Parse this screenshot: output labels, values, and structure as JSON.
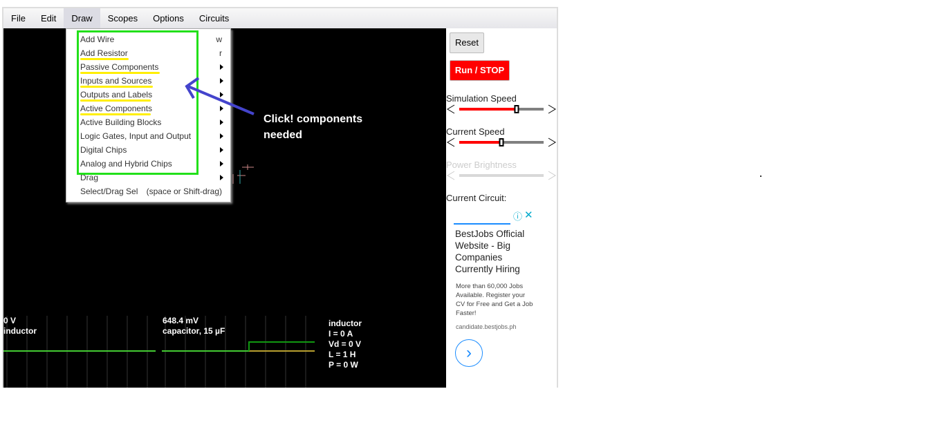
{
  "menubar": {
    "items": [
      "File",
      "Edit",
      "Draw",
      "Scopes",
      "Options",
      "Circuits"
    ],
    "active": "Draw"
  },
  "draw_menu": {
    "items": [
      {
        "label": "Add Wire",
        "shortcut": "w"
      },
      {
        "label": "Add Resistor",
        "shortcut": "r"
      },
      {
        "label": "Passive Components",
        "submenu": true
      },
      {
        "label": "Inputs and Sources",
        "submenu": true
      },
      {
        "label": "Outputs and Labels",
        "submenu": true
      },
      {
        "label": "Active Components",
        "submenu": true
      },
      {
        "label": "Active Building Blocks",
        "submenu": true
      },
      {
        "label": "Logic Gates, Input and Output",
        "submenu": true
      },
      {
        "label": "Digital Chips",
        "submenu": true
      },
      {
        "label": "Analog and Hybrid Chips",
        "submenu": true
      },
      {
        "label": "Drag",
        "submenu": true
      },
      {
        "label": "Select/Drag Sel",
        "shortcut": "(space or Shift-drag)"
      }
    ]
  },
  "annotation": {
    "line1": "Click! components",
    "line2": "needed",
    "box_color": "#22e01a",
    "underline_color": "#ffef00",
    "arrow_color": "#4444cc"
  },
  "panel": {
    "reset": "Reset",
    "run_stop": "Run / STOP",
    "simulation_speed": {
      "label": "Simulation Speed",
      "value": 0.68
    },
    "current_speed": {
      "label": "Current Speed",
      "value": 0.5
    },
    "power_brightness": {
      "label": "Power Brightness",
      "disabled": true
    },
    "current_circuit": "Current Circuit:"
  },
  "ad": {
    "title": "BestJobs Official Website - Big Companies Currently Hiring",
    "body": "More than 60,000 Jobs Available. Register your CV for Free and Get a Job Faster!",
    "domain": "candidate.bestjobs.ph"
  },
  "scopes": [
    {
      "value": "0 V",
      "name": "inductor"
    },
    {
      "value": "648.4 mV",
      "name": "capacitor, 15 µF"
    }
  ],
  "info": [
    "inductor",
    "I = 0 A",
    "Vd = 0 V",
    "L = 1 H",
    "P = 0 W"
  ]
}
